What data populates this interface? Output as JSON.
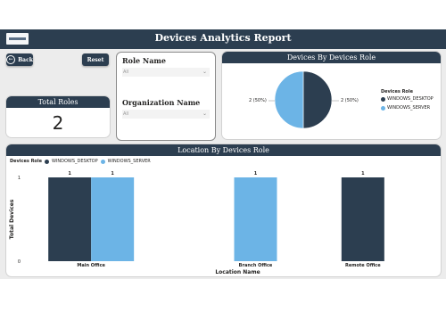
{
  "header": {
    "title": "Devices Analytics Report"
  },
  "buttons": {
    "back_label": "Back",
    "back_icon": "←",
    "reset_label": "Reset"
  },
  "total_roles": {
    "title": "Total Roles",
    "value": "2"
  },
  "filters": {
    "role": {
      "label": "Role Name",
      "value": "All"
    },
    "organization": {
      "label": "Organization Name",
      "value": "All"
    },
    "chevron": "⌄"
  },
  "colors": {
    "dark": "#2c3e50",
    "light": "#6cb4e6",
    "header": "#2c3e50"
  },
  "pie": {
    "title": "Devices By Devices Role",
    "left_label": "2 (50%)",
    "right_label": "2 (50%)",
    "legend_title": "Devices Role",
    "legend": [
      "WINDOWS_DESKTOP",
      "WINDOWS_SERVER"
    ]
  },
  "location": {
    "title": "Location By Devices Role",
    "legend_title": "Devices Role"
  },
  "chart_data": [
    {
      "type": "pie",
      "title": "Devices By Devices Role",
      "legend_title": "Devices Role",
      "labels": [
        "WINDOWS_DESKTOP",
        "WINDOWS_SERVER"
      ],
      "values": [
        2,
        2
      ],
      "value_labels": [
        "2 (50%)",
        "2 (50%)"
      ]
    },
    {
      "type": "bar",
      "title": "Location By Devices Role",
      "xlabel": "Location Name",
      "ylabel": "Total Devices",
      "categories": [
        "Main Office",
        "Branch Office",
        "Remote Office"
      ],
      "series": [
        {
          "name": "WINDOWS_DESKTOP",
          "values": [
            1,
            null,
            1
          ]
        },
        {
          "name": "WINDOWS_SERVER",
          "values": [
            1,
            1,
            null
          ]
        }
      ],
      "ylim": [
        0,
        1
      ],
      "yticks": [
        "0",
        "1"
      ],
      "legend_title": "Devices Role",
      "legend_position": "top-left"
    }
  ]
}
